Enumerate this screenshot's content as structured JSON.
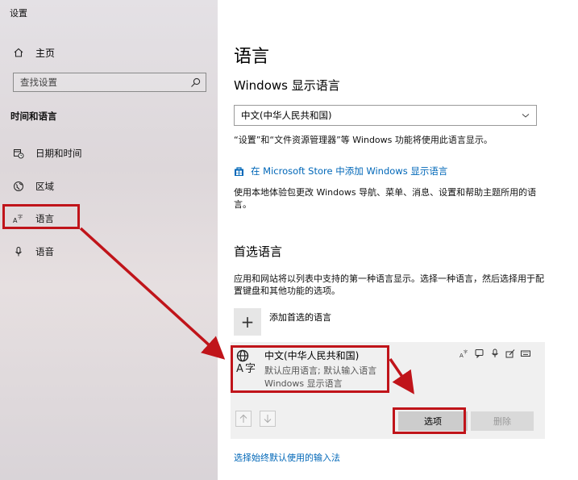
{
  "window": {
    "title": "设置"
  },
  "sidebar": {
    "home_label": "主页",
    "search_placeholder": "查找设置",
    "section_header": "时间和语言",
    "items": [
      {
        "label": "日期和时间",
        "icon": "calendar-clock-icon"
      },
      {
        "label": "区域",
        "icon": "globe-region-icon"
      },
      {
        "label": "语言",
        "icon": "language-icon"
      },
      {
        "label": "语音",
        "icon": "microphone-icon"
      }
    ]
  },
  "main": {
    "page_title": "语言",
    "display_language": {
      "heading": "Windows 显示语言",
      "selected": "中文(中华人民共和国)",
      "description": "“设置”和“文件资源管理器”等 Windows 功能将使用此语言显示。",
      "store_link": "在 Microsoft Store 中添加 Windows 显示语言",
      "store_description": "使用本地体验包更改 Windows 导航、菜单、消息、设置和帮助主题所用的语言。"
    },
    "preferred": {
      "heading": "首选语言",
      "description": "应用和网站将以列表中支持的第一种语言显示。选择一种语言，然后选择用于配置键盘和其他功能的选项。",
      "add_label": "添加首选的语言",
      "language": {
        "name": "中文(中华人民共和国)",
        "line2": "默认应用语言; 默认输入语言",
        "line3": "Windows 显示语言"
      },
      "options_button": "选项",
      "delete_button": "删除"
    },
    "bottom_link": "选择始终默认使用的输入法"
  },
  "colors": {
    "accent": "#0067b8",
    "annotation_red": "#c0141a"
  }
}
